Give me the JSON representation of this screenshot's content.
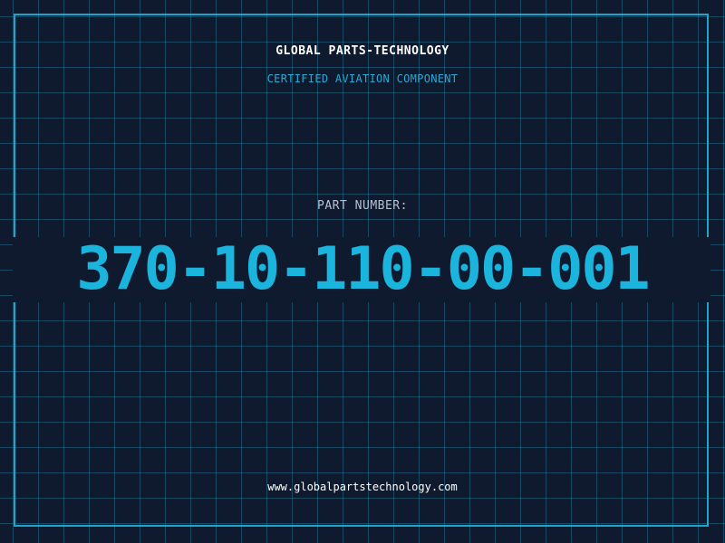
{
  "header": {
    "company": "GLOBAL PARTS-TECHNOLOGY",
    "subtitle": "CERTIFIED AVIATION COMPONENT"
  },
  "part": {
    "label": "PART NUMBER:",
    "number": "370-10-110-00-001"
  },
  "footer": {
    "url": "www.globalpartstechnology.com"
  },
  "colors": {
    "background": "#0f1a2e",
    "accent": "#1ab4dd",
    "frame": "#1fa4cc",
    "grid": "#1e6e8c",
    "label": "#b6c2d2",
    "title": "#ffffff"
  }
}
